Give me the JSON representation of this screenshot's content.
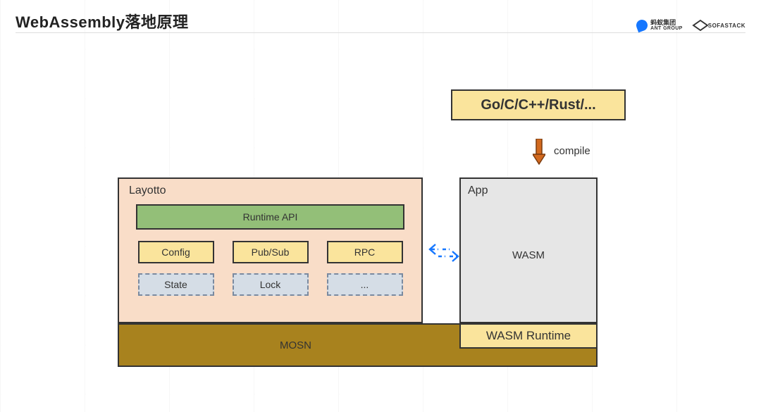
{
  "title": "WebAssembly落地原理",
  "logos": {
    "ant_cn": "蚂蚁集团",
    "ant_en": "ANT GROUP",
    "sofa": "SOFASTACK"
  },
  "lang_box": "Go/C/C++/Rust/...",
  "compile_label": "compile",
  "app": {
    "title": "App",
    "body": "WASM"
  },
  "wasm_runtime": "WASM Runtime",
  "mosn": "MOSN",
  "layotto": {
    "title": "Layotto",
    "runtime_api": "Runtime API",
    "row1": [
      "Config",
      "Pub/Sub",
      "RPC"
    ],
    "row2": [
      "State",
      "Lock",
      "..."
    ]
  }
}
